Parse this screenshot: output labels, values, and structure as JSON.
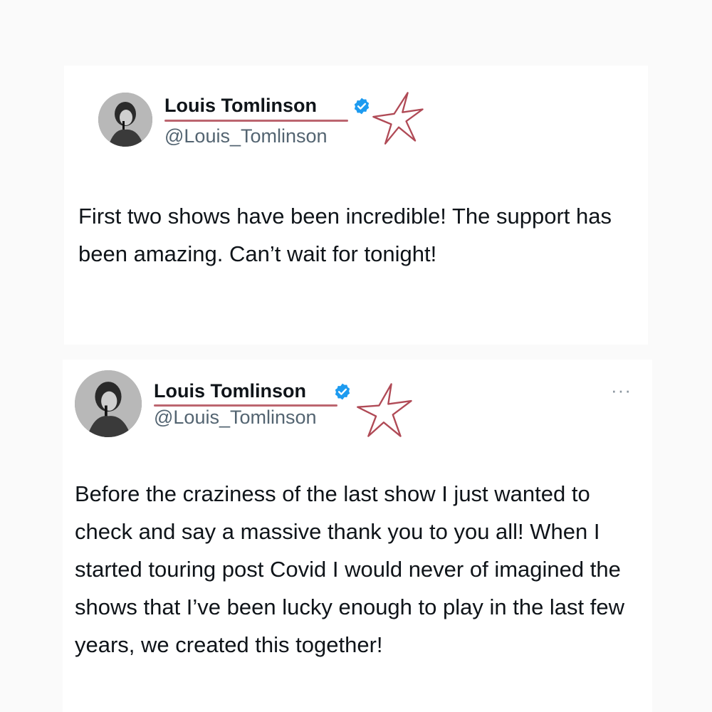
{
  "tweets": [
    {
      "author_name": "Louis Tomlinson",
      "handle": "@Louis_Tomlinson",
      "text_before_highlight": "First two shows have been incredible! The ",
      "highlight": "support has been amazing",
      "text_after_highlight": ". Can’t wait for tonight!"
    },
    {
      "author_name": "Louis Tomlinson",
      "handle": "@Louis_Tomlinson",
      "more_icon": "···",
      "text_before_highlight": "Before the craziness of the last show I just wanted to check and say a massive thank you to you all! When I started touring post Covid I would never of imagined the shows that I’ve been lucky enough to play in the last few years, ",
      "highlight": "we created this together",
      "text_after_highlight": "!"
    }
  ],
  "colors": {
    "verified_badge": "#1d9bf0",
    "star_doodle": "#b04a56",
    "highlight": "#f29fa6"
  },
  "icons": [
    "verified-badge-icon",
    "star-doodle-icon",
    "more-options-icon"
  ]
}
